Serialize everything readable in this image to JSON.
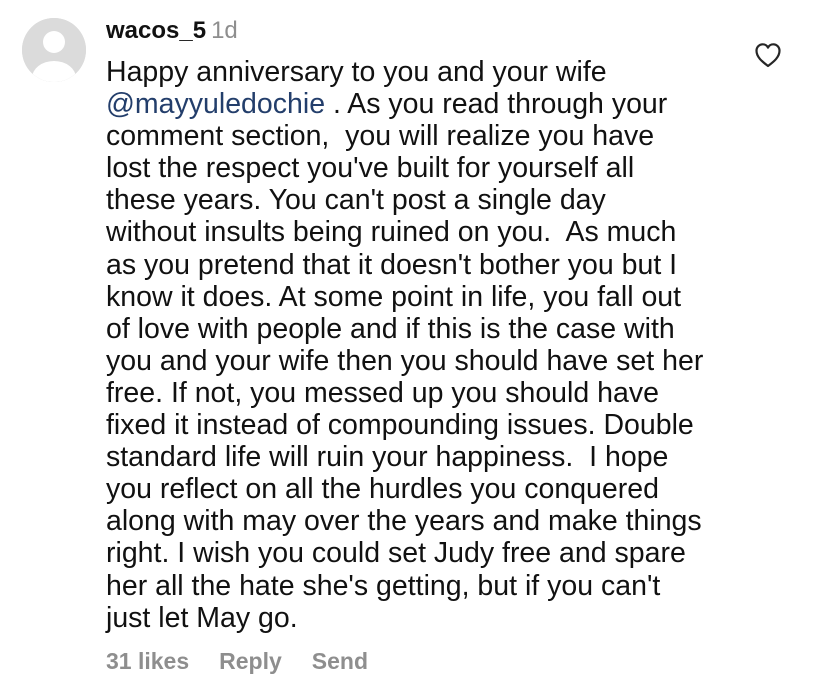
{
  "comment": {
    "username": "wacos_5",
    "time": "1d",
    "mention": "@mayyuledochie",
    "line1": "Happy anniversary to you and your wife",
    "line2_rest": " . As you read through your",
    "lines": [
      "comment section,  you will realize you have",
      "lost the respect you've built for yourself all",
      "these years. You can't post a single day",
      "without insults being ruined on you.  As much",
      "as you pretend that it doesn't bother you but I",
      "know it does. At some point in life, you fall out",
      "of love with people and if this is the case with",
      "you and your wife then you should have set her",
      "free. If not, you messed up you should have",
      "fixed it instead of compounding issues. Double",
      "standard life will ruin your happiness.  I hope",
      "you reflect on all the hurdles you conquered",
      "along with may over the years and make things",
      "right. I wish you could set Judy free and spare",
      "her all the hate she's getting, but if you can't",
      "just let May go."
    ]
  },
  "actions": {
    "likes": "31 likes",
    "reply": "Reply",
    "send": "Send"
  },
  "icons": {
    "avatar": "default-avatar-icon",
    "like": "heart-outline-icon"
  },
  "colors": {
    "text": "#111111",
    "muted": "#8e8e8e",
    "mention": "#233e6b",
    "avatar_bg": "#dbdbdb"
  }
}
